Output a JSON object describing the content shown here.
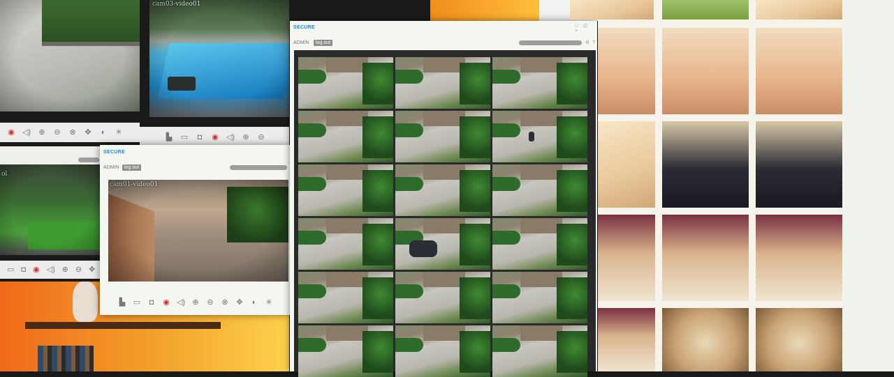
{
  "secure_window_main": {
    "title": "SECURE",
    "user": "ADMIN",
    "logout_label": "log out",
    "controls": "□ ⊡ ×",
    "settings_icons": "⚙ ?"
  },
  "secure_window_small": {
    "title": "SECURE",
    "user": "ADMIN",
    "logout_label": "log out"
  },
  "cameras": {
    "top_left_label": "",
    "pool_label": "cam03-video01",
    "patio_label": "cam01-video01",
    "mid_left_label": "ol"
  },
  "toolbar_icons": [
    "save-icon",
    "film-icon",
    "camera-icon",
    "record-icon",
    "volume-icon",
    "zoom-in-icon",
    "zoom-out-icon",
    "move-icon",
    "contrast-icon",
    "brightness-icon"
  ],
  "grid": {
    "rows": 6,
    "cols": 3
  }
}
